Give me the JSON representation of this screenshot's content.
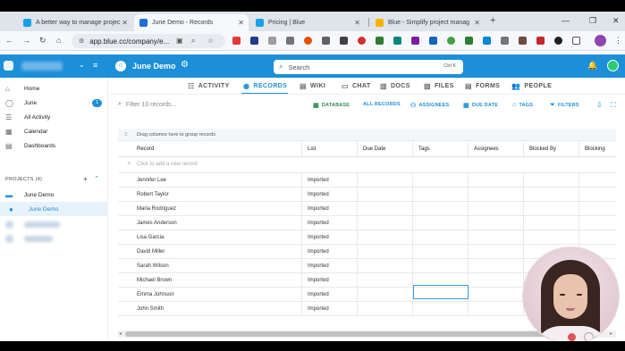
{
  "browser": {
    "tabs": [
      {
        "title": "A better way to manage projec",
        "favicon_color": "#1aa0e8"
      },
      {
        "title": "June Demo - Records",
        "favicon_color": "#1d6fd8"
      },
      {
        "title": "Pricing | Blue",
        "favicon_color": "#1aa0e8"
      },
      {
        "title": "Blue - Simplify project manag",
        "favicon_color": "#f4b400"
      }
    ],
    "url": "app.blue.cc/company/e..."
  },
  "app": {
    "project_title": "June Demo",
    "search_placeholder": "Search",
    "search_shortcut": "Ctrl K"
  },
  "sidebar": {
    "items": [
      {
        "label": "Home",
        "icon": "home-icon"
      },
      {
        "label": "June",
        "icon": "check-circle-icon",
        "badge": "1"
      },
      {
        "label": "All Activity",
        "icon": "activity-icon"
      },
      {
        "label": "Calendar",
        "icon": "calendar-icon"
      },
      {
        "label": "Dashboards",
        "icon": "dashboard-icon"
      }
    ],
    "projects_header": "PROJECTS (4)",
    "projects": [
      {
        "label": "June Demo",
        "icon": "folder-icon"
      },
      {
        "label": "June Demo",
        "icon": "project-icon",
        "active": true
      }
    ]
  },
  "nav": {
    "tabs": [
      "ACTIVITY",
      "RECORDS",
      "WIKI",
      "CHAT",
      "DOCS",
      "FILES",
      "FORMS",
      "PEOPLE"
    ],
    "active": "RECORDS"
  },
  "toolbar": {
    "filter_placeholder": "Filter 10 records...",
    "database": "DATABASE",
    "all_records": "ALL RECORDS",
    "assignees": "ASSIGNEES",
    "due_date": "DUE DATE",
    "tags": "TAGS",
    "filters": "FILTERS"
  },
  "table": {
    "group_hint": "Drag columns here to group records",
    "add_placeholder": "Click to add a new record",
    "columns": [
      "Record",
      "List",
      "Due Date",
      "Tags",
      "Assignees",
      "Blocked By",
      "Blocking"
    ],
    "rows": [
      {
        "record": "Jennifer Lee",
        "list": "Imported"
      },
      {
        "record": "Robert Taylor",
        "list": "Imported"
      },
      {
        "record": "Maria Rodriguez",
        "list": "Imported"
      },
      {
        "record": "James Anderson",
        "list": "Imported"
      },
      {
        "record": "Lisa Garcia",
        "list": "Imported"
      },
      {
        "record": "David Miller",
        "list": "Imported"
      },
      {
        "record": "Sarah Wilson",
        "list": "Imported"
      },
      {
        "record": "Michael Brown",
        "list": "Imported"
      },
      {
        "record": "Emma Johnson",
        "list": "Imported"
      },
      {
        "record": "John Smith",
        "list": "Imported"
      }
    ]
  },
  "colors": {
    "brand": "#1d8fd8",
    "selection": "#3a9ad9"
  }
}
